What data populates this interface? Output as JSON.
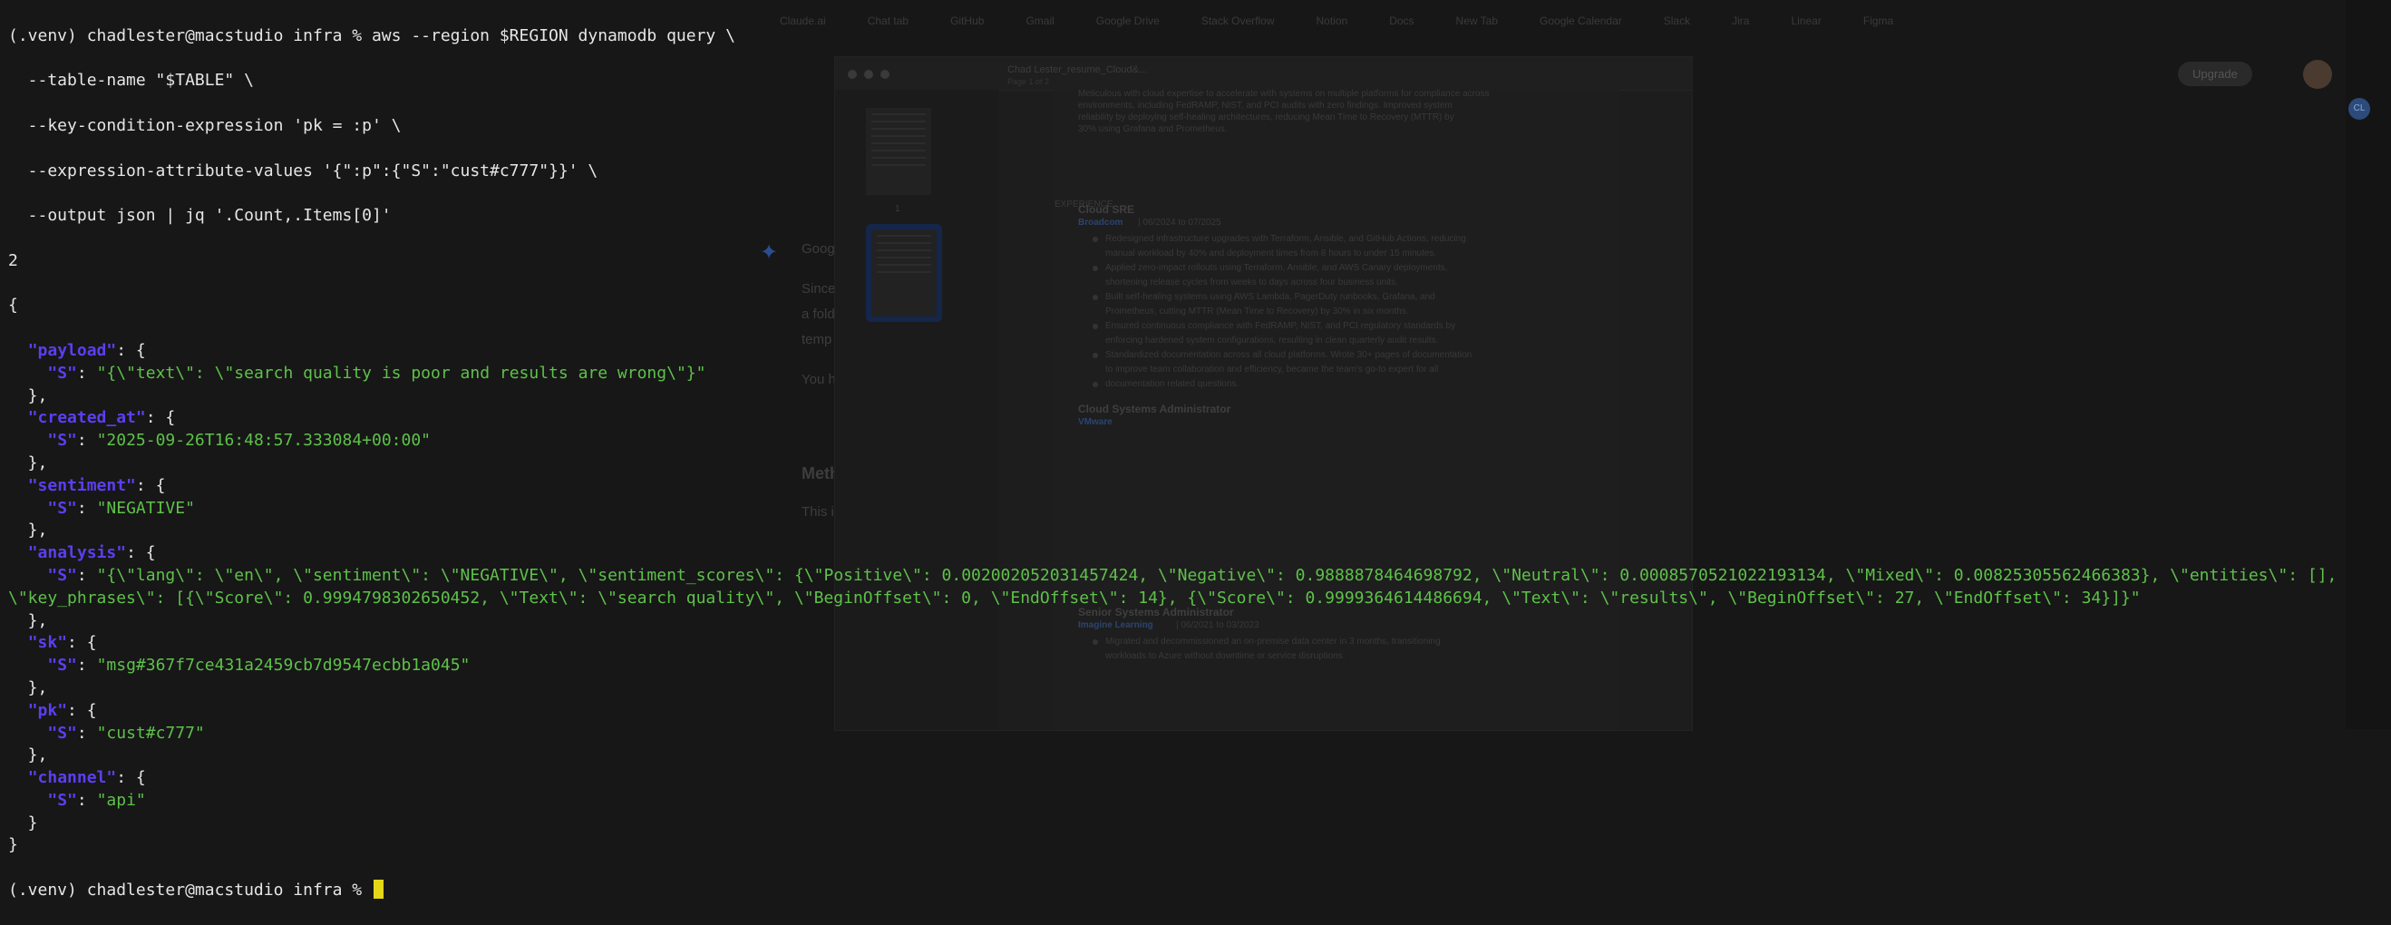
{
  "terminal": {
    "prompt": "(.venv) chadlester@macstudio infra % ",
    "command_lines": [
      "aws --region $REGION dynamodb query \\",
      "  --table-name \"$TABLE\" \\",
      "  --key-condition-expression 'pk = :p' \\",
      "  --expression-attribute-values '{\":p\":{\"S\":\"cust#c777\"}}' \\",
      "  --output json | jq '.Count,.Items[0]'"
    ],
    "count_output": "2",
    "open_brace": "{",
    "close_brace": "}",
    "fields": [
      {
        "key": "\"payload\"",
        "type": "\"S\"",
        "value": "\"{\\\"text\\\": \\\"search quality is poor and results are wrong\\\"}\""
      },
      {
        "key": "\"created_at\"",
        "type": "\"S\"",
        "value": "\"2025-09-26T16:48:57.333084+00:00\""
      },
      {
        "key": "\"sentiment\"",
        "type": "\"S\"",
        "value": "\"NEGATIVE\""
      },
      {
        "key": "\"analysis\"",
        "type": "\"S\"",
        "value": "\"{\\\"lang\\\": \\\"en\\\", \\\"sentiment\\\": \\\"NEGATIVE\\\", \\\"sentiment_scores\\\": {\\\"Positive\\\": 0.002002052031457424, \\\"Negative\\\": 0.9888878464698792, \\\"Neutral\\\": 0.0008570521022193134, \\\"Mixed\\\": 0.00825305562466383}, \\\"entities\\\": [],",
        "value_cont": "\\\"key_phrases\\\": [{\\\"Score\\\": 0.9994798302650452, \\\"Text\\\": \\\"search quality\\\", \\\"BeginOffset\\\": 0, \\\"EndOffset\\\": 14}, {\\\"Score\\\": 0.9999364614486694, \\\"Text\\\": \\\"results\\\", \\\"BeginOffset\\\": 27, \\\"EndOffset\\\": 34}]}\""
      },
      {
        "key": "\"sk\"",
        "type": "\"S\"",
        "value": "\"msg#367f7ce431a2459cb7d9547ecbb1a045\""
      },
      {
        "key": "\"pk\"",
        "type": "\"S\"",
        "value": "\"cust#c777\""
      },
      {
        "key": "\"channel\"",
        "type": "\"S\"",
        "value": "\"api\""
      }
    ]
  },
  "background": {
    "pdf_title": "Chad Lester_resume_Cloud&...",
    "pdf_pages_label": "Page 1 of 2",
    "pdf_page_number": "1",
    "ai_panel_brand": "Googl",
    "ai_para_lines": [
      "Since",
      "a fold",
      "temp",
      "You h",
      "Meth",
      "This i"
    ],
    "upgrade_label": "Upgrade",
    "rail_badge": "CL",
    "section_heading_1": "Cloud SRE",
    "company_1": "Broadcom",
    "dates_1": "| 06/2024 to 07/2025",
    "section_heading_2": "Cloud Systems Administrator",
    "company_2": "VMware",
    "section_heading_3": "Senior Systems Administrator",
    "company_3": "Imagine Learning",
    "dates_3": "| 06/2021 to 03/2023",
    "left_col_label": "EXPERIENCE",
    "intro_lines": [
      "Meticulous with cloud expertise to accelerate with systems  on multiple platforms for compliance across",
      "environments, including FedRAMP, NIST, and PCI audits with zero findings. Improved system",
      "reliability by deploying self-healing architectures, reducing Mean Time to Recovery (MTTR) by",
      "30% using Grafana and Prometheus."
    ],
    "bullets_1": [
      "Redesigned infrastructure upgrades with Terraform, Ansible, and GitHub Actions, reducing",
      "manual workload by 40% and deployment times from 8 hours to under 15 minutes.",
      "Applied zero-impact rollouts using Terraform, Ansible, and AWS Canary deployments,",
      "shortening release cycles from weeks to days across four business units.",
      "Built self-healing systems using AWS Lambda, PagerDuty runbooks, Grafana, and",
      "Prometheus, cutting MTTR (Mean Time to Recovery) by 30% in six months.",
      "Ensured continuous compliance with FedRAMP, NIST, and PCI regulatory standards by",
      "enforcing hardened system configurations, resulting in clean quarterly audit results.",
      "Standardized documentation across all cloud platforms. Wrote 30+ pages of documentation",
      "to improve team collaboration and efficiency, became the team's go-to expert for all",
      "documentation related questions."
    ],
    "bullets_3": [
      "Migrated and decommissioned an on-premise data center in 3 months, transitioning",
      "workloads to Azure without downtime or service disruptions."
    ],
    "tab_labels": [
      "Claude.ai",
      "Chat tab",
      "GitHub",
      "Gmail",
      "Google Drive",
      "Stack Overflow",
      "Notion",
      "Docs",
      "New Tab",
      "Google Calendar",
      "Slack",
      "Jira",
      "Linear",
      "Figma"
    ]
  }
}
